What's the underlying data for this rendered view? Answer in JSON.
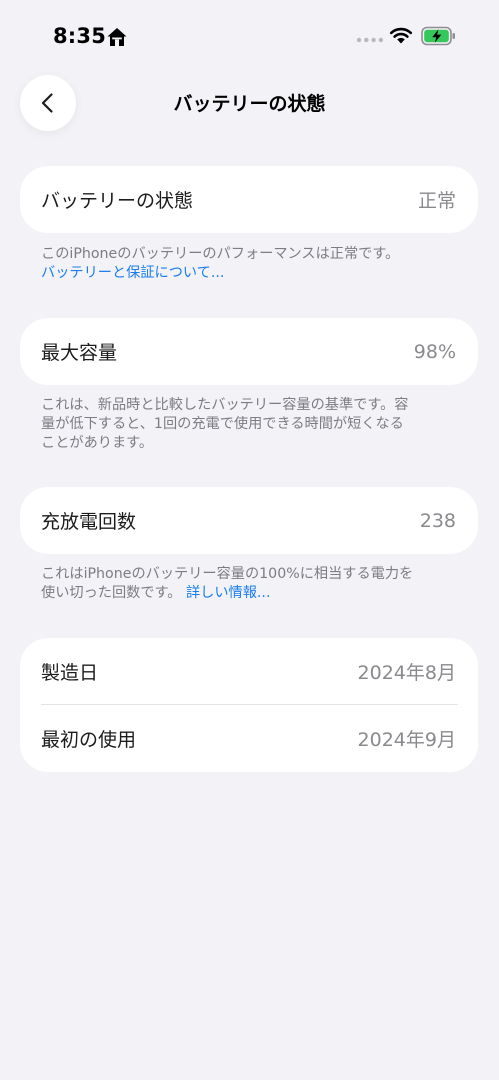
{
  "status_bar": {
    "time": "8:35",
    "icons": [
      "home-icon",
      "cellular-dots-icon",
      "wifi-icon",
      "battery-charging-icon"
    ],
    "battery_color": "#34c759"
  },
  "nav": {
    "back_icon": "chevron-left-icon",
    "title": "バッテリーの状態"
  },
  "battery_health": {
    "label": "バッテリーの状態",
    "value": "正常",
    "footnote": "このiPhoneのバッテリーのパフォーマンスは正常です。",
    "link": "バッテリーと保証について..."
  },
  "max_capacity": {
    "label": "最大容量",
    "value": "98%",
    "footnote_lines": [
      "これは、新品時と比較したバッテリー容量の基準です。容",
      "量が低下すると、1回の充電で使用できる時間が短くなる",
      "ことがあります。"
    ]
  },
  "cycle_count": {
    "label": "充放電回数",
    "value": "238",
    "footnote_line1": "これはiPhoneのバッテリー容量の100%に相当する電力を",
    "footnote_line2": "使い切った回数です。",
    "link": "詳しい情報..."
  },
  "dates": {
    "manufacture_label": "製造日",
    "manufacture_value": "2024年8月",
    "first_use_label": "最初の使用",
    "first_use_value": "2024年9月"
  },
  "colors": {
    "background": "#f2f2f7",
    "card": "#ffffff",
    "link": "#1a7ef0",
    "secondary_text": "#8a8a8e"
  }
}
